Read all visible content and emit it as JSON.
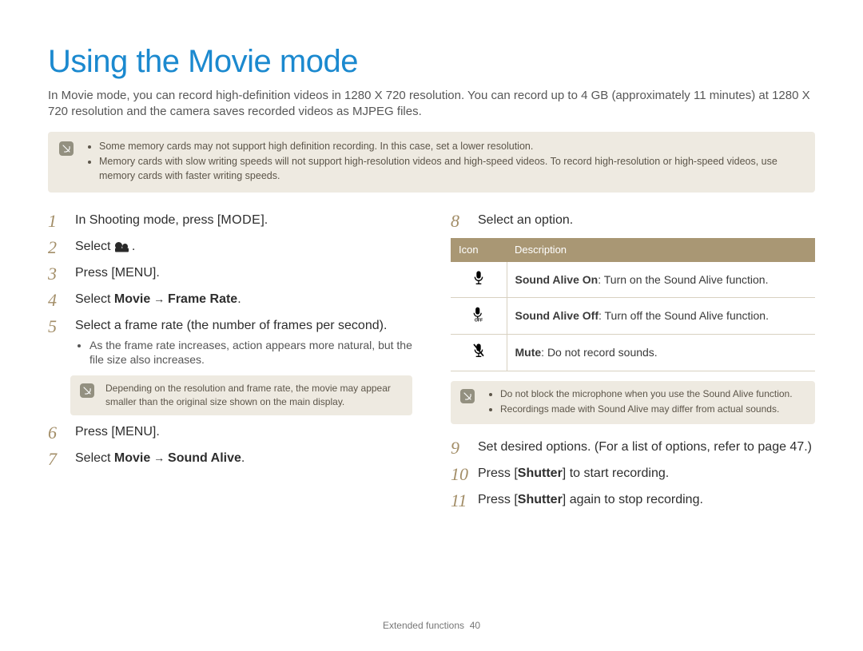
{
  "title": "Using the Movie mode",
  "intro": "In Movie mode, you can record high-definition videos in 1280 X 720 resolution. You can record up to 4 GB (approximately 11 minutes) at 1280 X 720 resolution and the camera saves recorded videos as MJPEG files.",
  "top_notes": [
    "Some memory cards may not support high definition recording. In this case, set a lower resolution.",
    "Memory cards with slow writing speeds will not support high-resolution videos and high-speed videos. To record high-resolution or high-speed videos, use memory cards with faster writing speeds."
  ],
  "steps": {
    "s1_a": "In Shooting mode, press [",
    "s1_b": "MODE",
    "s1_c": "].",
    "s2": "Select ",
    "s2_end": ".",
    "s3_a": "Press [",
    "s3_b": "MENU",
    "s3_c": "].",
    "s4_a": "Select ",
    "s4_b": "Movie",
    "s4_arrow": " → ",
    "s4_c": "Frame Rate",
    "s4_d": ".",
    "s5": "Select a frame rate (the number of frames per second).",
    "s5_sub": "As the frame rate increases, action appears more natural, but the file size also increases.",
    "s5_note": "Depending on the resolution and frame rate, the movie may appear smaller than the original size shown on the main display.",
    "s6_a": "Press [",
    "s6_b": "MENU",
    "s6_c": "].",
    "s7_a": "Select ",
    "s7_b": "Movie",
    "s7_arrow": " → ",
    "s7_c": "Sound Alive",
    "s7_d": ".",
    "s8": "Select an option.",
    "s9": "Set desired options. (For a list of options, refer to page 47.)",
    "s10_a": "Press [",
    "s10_b": "Shutter",
    "s10_c": "] to start recording.",
    "s11_a": "Press [",
    "s11_b": "Shutter",
    "s11_c": "] again to stop recording."
  },
  "table": {
    "header_icon": "Icon",
    "header_desc": "Description",
    "rows": [
      {
        "icon": "mic-on-icon",
        "bold": "Sound Alive On",
        "rest": ": Turn on the Sound Alive function."
      },
      {
        "icon": "mic-off-icon",
        "bold": "Sound Alive Off",
        "rest": ": Turn off the Sound Alive function."
      },
      {
        "icon": "mic-mute-icon",
        "bold": "Mute",
        "rest": ": Do not record sounds."
      }
    ]
  },
  "right_notes": [
    "Do not block the microphone when you use the Sound Alive function.",
    "Recordings made with Sound Alive may differ from actual sounds."
  ],
  "footer_section": "Extended functions",
  "footer_page": "40"
}
